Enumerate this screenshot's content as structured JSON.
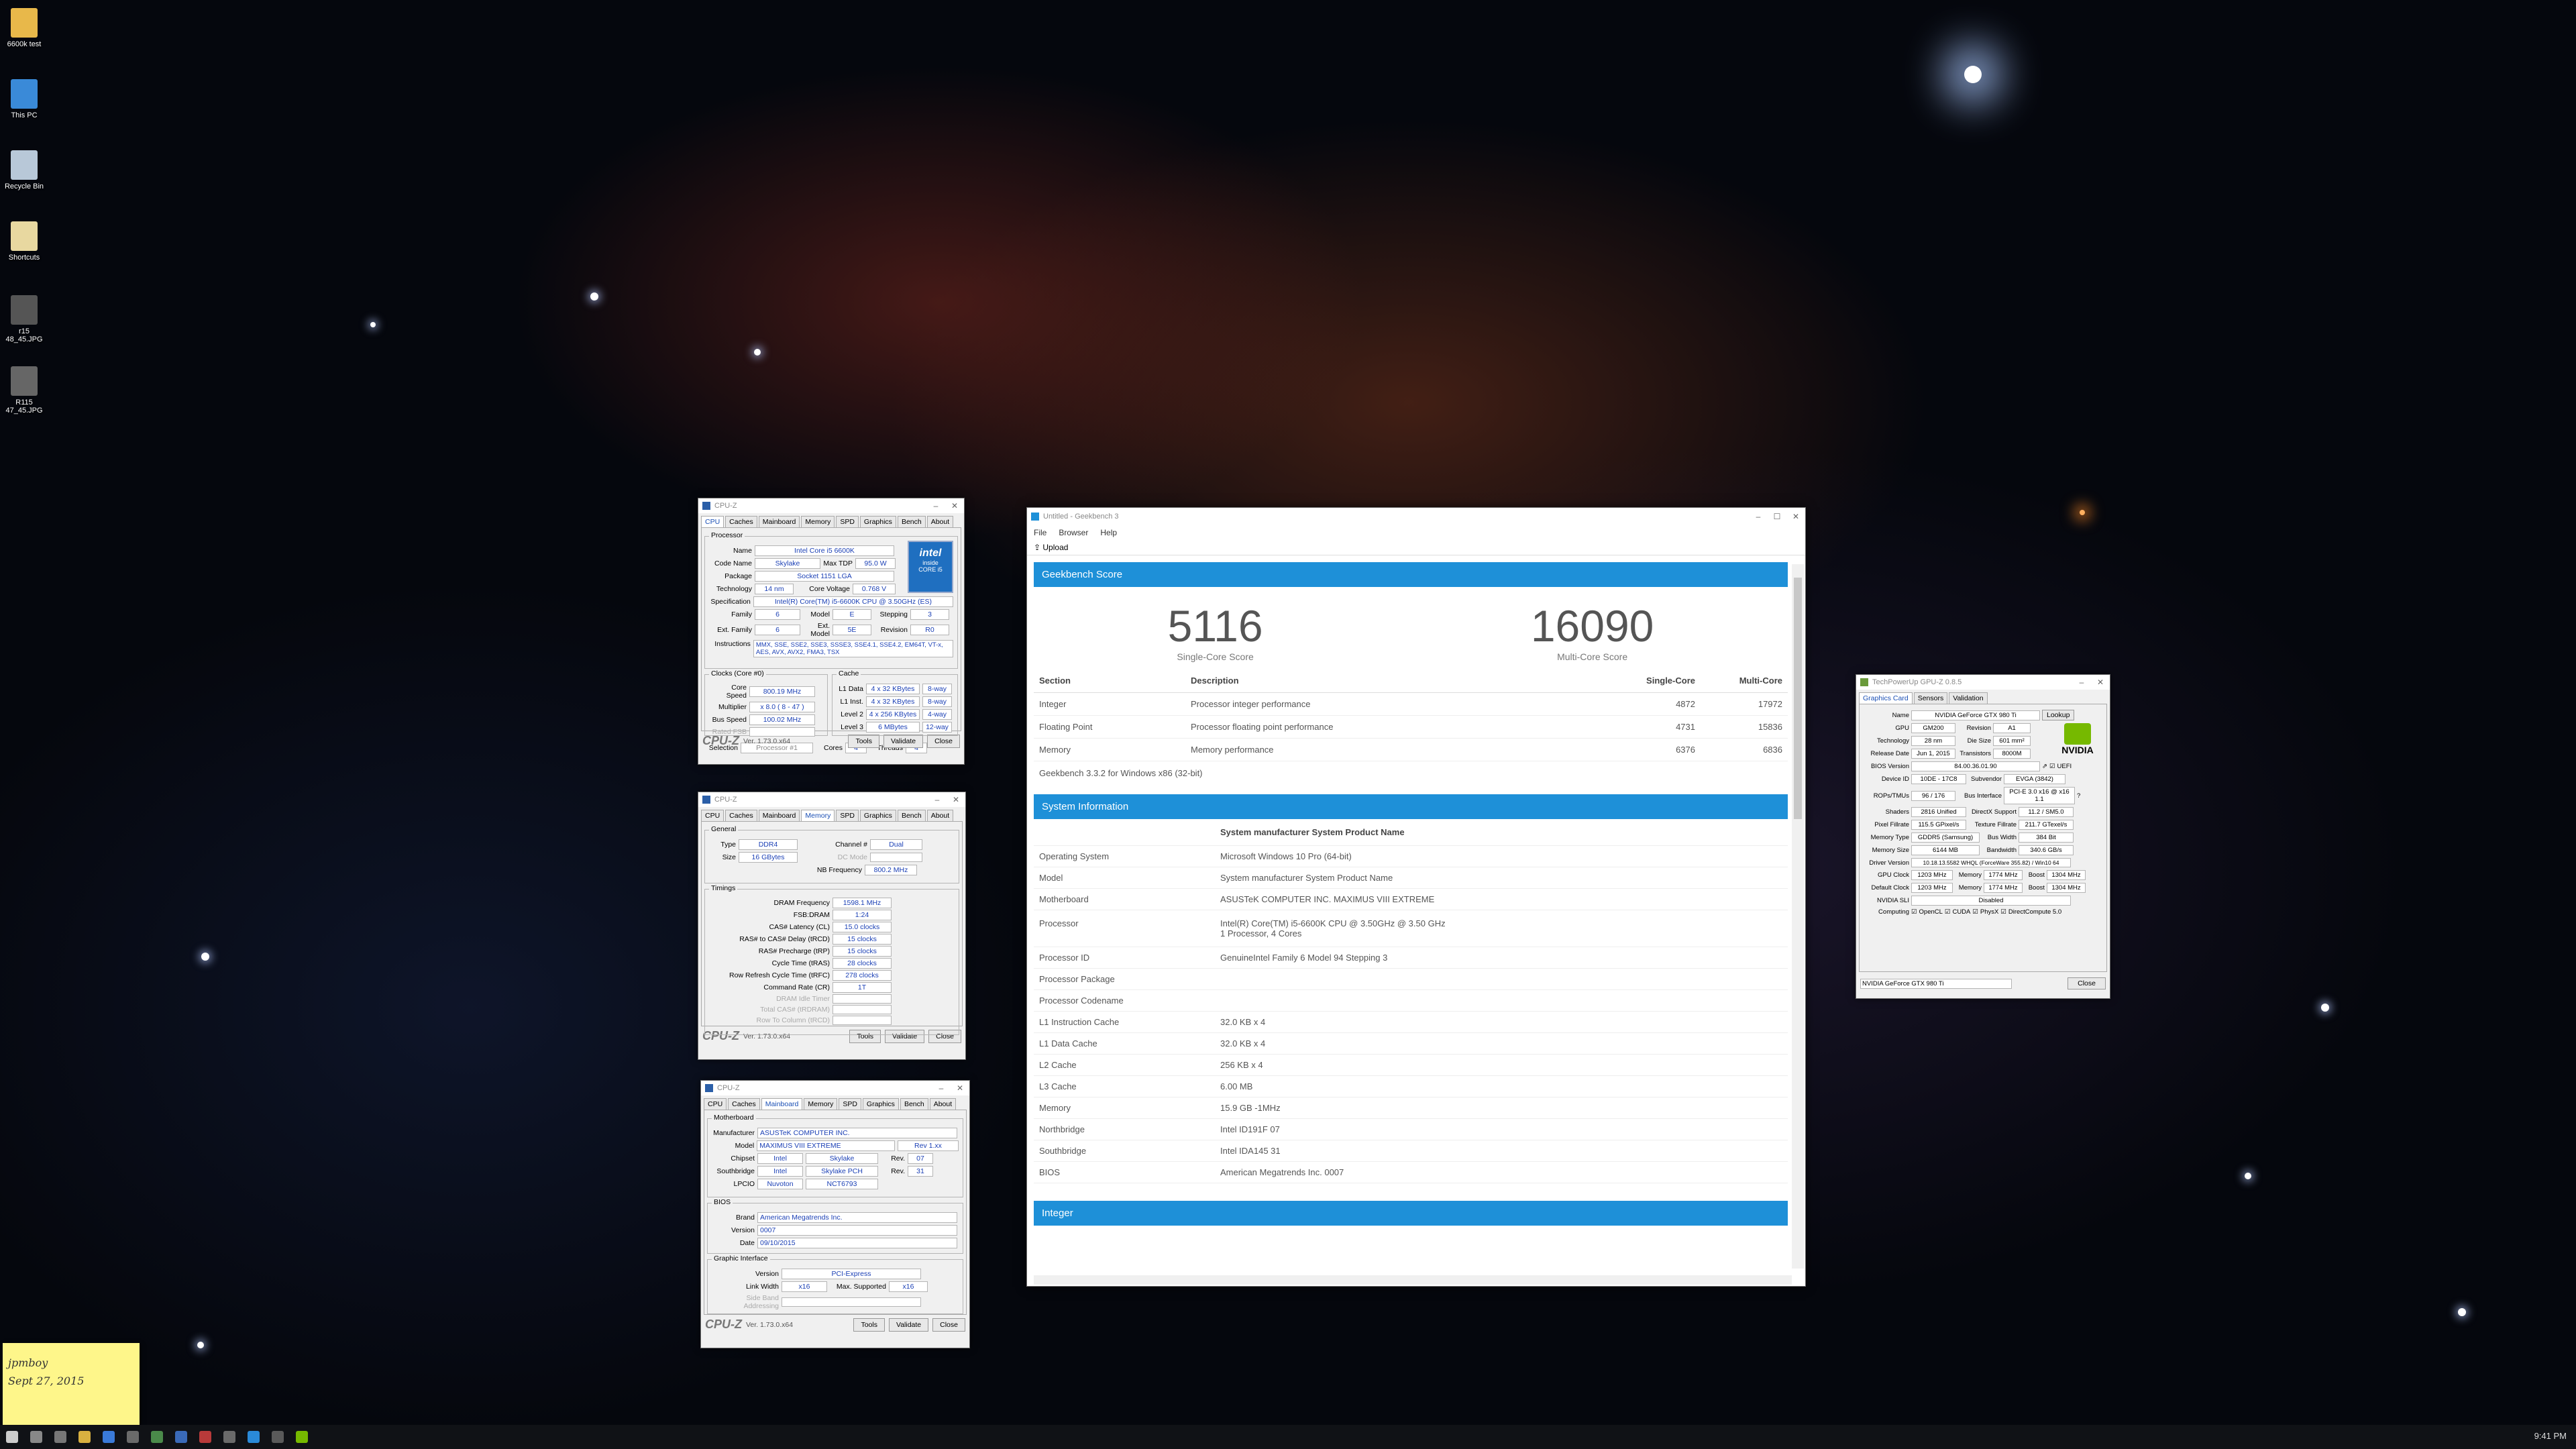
{
  "desktop": {
    "icons": [
      {
        "label": "6600k test"
      },
      {
        "label": "This PC"
      },
      {
        "label": "Recycle Bin"
      },
      {
        "label": "Shortcuts"
      },
      {
        "label": "r15 48_45.JPG"
      },
      {
        "label": "R115 47_45.JPG"
      }
    ]
  },
  "cpuz_cpu": {
    "title": "CPU-Z",
    "tabs": [
      "CPU",
      "Caches",
      "Mainboard",
      "Memory",
      "SPD",
      "Graphics",
      "Bench",
      "About"
    ],
    "active_tab": "CPU",
    "group_processor": "Processor",
    "name_label": "Name",
    "name": "Intel Core i5 6600K",
    "codename_label": "Code Name",
    "codename": "Skylake",
    "maxtdp_label": "Max TDP",
    "maxtdp": "95.0 W",
    "package_label": "Package",
    "package": "Socket 1151 LGA",
    "technology_label": "Technology",
    "technology": "14 nm",
    "voltage_label": "Core Voltage",
    "voltage": "0.768 V",
    "spec_label": "Specification",
    "spec": "Intel(R) Core(TM) i5-6600K CPU @ 3.50GHz (ES)",
    "family_label": "Family",
    "family": "6",
    "model_label": "Model",
    "model": "E",
    "stepping_label": "Stepping",
    "stepping": "3",
    "extfamily_label": "Ext. Family",
    "extfamily": "6",
    "extmodel_label": "Ext. Model",
    "extmodel": "5E",
    "revision_label": "Revision",
    "revision": "R0",
    "instructions_label": "Instructions",
    "instructions": "MMX, SSE, SSE2, SSE3, SSSE3, SSE4.1, SSE4.2, EM64T, VT-x, AES, AVX, AVX2, FMA3, TSX",
    "group_clocks": "Clocks (Core #0)",
    "corespeed_label": "Core Speed",
    "corespeed": "800.19 MHz",
    "multiplier_label": "Multiplier",
    "multiplier": "x 8.0 ( 8 - 47 )",
    "busspeed_label": "Bus Speed",
    "busspeed": "100.02 MHz",
    "ratedfsb_label": "Rated FSB",
    "group_cache": "Cache",
    "l1d_label": "L1 Data",
    "l1d": "4 x 32 KBytes",
    "l1d_way": "8-way",
    "l1i_label": "L1 Inst.",
    "l1i": "4 x 32 KBytes",
    "l1i_way": "8-way",
    "l2_label": "Level 2",
    "l2": "4 x 256 KBytes",
    "l2_way": "4-way",
    "l3_label": "Level 3",
    "l3": "6 MBytes",
    "l3_way": "12-way",
    "selection_label": "Selection",
    "selection": "Processor #1",
    "cores_label": "Cores",
    "cores": "4",
    "threads_label": "Threads",
    "threads": "4",
    "logo": "CPU-Z",
    "version": "Ver. 1.73.0.x64",
    "tools": "Tools",
    "validate": "Validate",
    "close": "Close",
    "intel_logo": "intel",
    "intel_inside": "inside",
    "intel_core": "CORE i5"
  },
  "cpuz_mem": {
    "title": "CPU-Z",
    "tabs": [
      "CPU",
      "Caches",
      "Mainboard",
      "Memory",
      "SPD",
      "Graphics",
      "Bench",
      "About"
    ],
    "active_tab": "Memory",
    "group_general": "General",
    "type_label": "Type",
    "type": "DDR4",
    "channel_label": "Channel #",
    "channel": "Dual",
    "size_label": "Size",
    "size": "16 GBytes",
    "dcmode_label": "DC Mode",
    "nbfreq_label": "NB Frequency",
    "nbfreq": "800.2 MHz",
    "group_timings": "Timings",
    "timings": [
      {
        "label": "DRAM Frequency",
        "value": "1598.1 MHz"
      },
      {
        "label": "FSB:DRAM",
        "value": "1:24"
      },
      {
        "label": "CAS# Latency (CL)",
        "value": "15.0 clocks"
      },
      {
        "label": "RAS# to CAS# Delay (tRCD)",
        "value": "15 clocks"
      },
      {
        "label": "RAS# Precharge (tRP)",
        "value": "15 clocks"
      },
      {
        "label": "Cycle Time (tRAS)",
        "value": "28 clocks"
      },
      {
        "label": "Row Refresh Cycle Time (tRFC)",
        "value": "278 clocks"
      },
      {
        "label": "Command Rate (CR)",
        "value": "1T"
      },
      {
        "label": "DRAM Idle Timer",
        "value": ""
      },
      {
        "label": "Total CAS# (tRDRAM)",
        "value": ""
      },
      {
        "label": "Row To Column (tRCD)",
        "value": ""
      }
    ],
    "logo": "CPU-Z",
    "version": "Ver. 1.73.0.x64",
    "tools": "Tools",
    "validate": "Validate",
    "close": "Close"
  },
  "cpuz_mb": {
    "title": "CPU-Z",
    "tabs": [
      "CPU",
      "Caches",
      "Mainboard",
      "Memory",
      "SPD",
      "Graphics",
      "Bench",
      "About"
    ],
    "active_tab": "Mainboard",
    "group_motherboard": "Motherboard",
    "manufacturer_label": "Manufacturer",
    "manufacturer": "ASUSTeK COMPUTER INC.",
    "model_label": "Model",
    "model": "MAXIMUS VIII EXTREME",
    "model_rev": "Rev 1.xx",
    "chipset_label": "Chipset",
    "chipset_vendor": "Intel",
    "chipset": "Skylake",
    "chipset_rev_label": "Rev.",
    "chipset_rev": "07",
    "southbridge_label": "Southbridge",
    "sb_vendor": "Intel",
    "southbridge": "Skylake PCH",
    "sb_rev_label": "Rev.",
    "sb_rev": "31",
    "lpcio_label": "LPCIO",
    "lpcio_vendor": "Nuvoton",
    "lpcio": "NCT6793",
    "group_bios": "BIOS",
    "brand_label": "Brand",
    "brand": "American Megatrends Inc.",
    "version_label": "Version",
    "bios_version": "0007",
    "date_label": "Date",
    "date": "09/10/2015",
    "group_graphic": "Graphic Interface",
    "gi_version_label": "Version",
    "gi_version": "PCI-Express",
    "linkwidth_label": "Link Width",
    "linkwidth": "x16",
    "maxsupported_label": "Max. Supported",
    "maxsupported": "x16",
    "sideband_label": "Side Band Addressing",
    "logo": "CPU-Z",
    "version": "Ver. 1.73.0.x64",
    "tools": "Tools",
    "validate": "Validate",
    "close": "Close"
  },
  "geekbench": {
    "title": "Untitled - Geekbench 3",
    "menu": [
      "File",
      "Browser",
      "Help"
    ],
    "toolbar_upload": "Upload",
    "score_header": "Geekbench Score",
    "single_score": "5116",
    "single_caption": "Single-Core Score",
    "multi_score": "16090",
    "multi_caption": "Multi-Core Score",
    "table_headers": {
      "section": "Section",
      "description": "Description",
      "single": "Single-Core",
      "multi": "Multi-Core"
    },
    "rows": [
      {
        "section": "Integer",
        "description": "Processor integer performance",
        "single": "4872",
        "multi": "17972"
      },
      {
        "section": "Floating Point",
        "description": "Processor floating point performance",
        "single": "4731",
        "multi": "15836"
      },
      {
        "section": "Memory",
        "description": "Memory performance",
        "single": "6376",
        "multi": "6836"
      }
    ],
    "version_note": "Geekbench 3.3.2 for Windows x86 (32-bit)",
    "sysinfo_header": "System Information",
    "sysinfo_title": "System manufacturer System Product Name",
    "sysinfo": [
      {
        "k": "Operating System",
        "v": "Microsoft Windows 10 Pro (64-bit)"
      },
      {
        "k": "Model",
        "v": "System manufacturer System Product Name"
      },
      {
        "k": "Motherboard",
        "v": "ASUSTeK COMPUTER INC. MAXIMUS VIII EXTREME"
      },
      {
        "k": "Processor",
        "v": "Intel(R) Core(TM) i5-6600K CPU @ 3.50GHz @ 3.50 GHz",
        "v2": "1 Processor, 4 Cores"
      },
      {
        "k": "Processor ID",
        "v": "GenuineIntel Family 6 Model 94 Stepping 3"
      },
      {
        "k": "Processor Package",
        "v": ""
      },
      {
        "k": "Processor Codename",
        "v": ""
      },
      {
        "k": "L1 Instruction Cache",
        "v": "32.0 KB x 4"
      },
      {
        "k": "L1 Data Cache",
        "v": "32.0 KB x 4"
      },
      {
        "k": "L2 Cache",
        "v": "256 KB x 4"
      },
      {
        "k": "L3 Cache",
        "v": "6.00 MB"
      },
      {
        "k": "Memory",
        "v": "15.9 GB -1MHz"
      },
      {
        "k": "Northbridge",
        "v": "Intel ID191F 07"
      },
      {
        "k": "Southbridge",
        "v": "Intel IDA145 31"
      },
      {
        "k": "BIOS",
        "v": "American Megatrends Inc. 0007"
      }
    ],
    "integer_header": "Integer"
  },
  "gpuz": {
    "title": "TechPowerUp GPU-Z 0.8.5",
    "tabs": [
      "Graphics Card",
      "Sensors",
      "Validation"
    ],
    "lookup": "Lookup",
    "name_label": "Name",
    "name": "NVIDIA GeForce GTX 980 Ti",
    "gpu_label": "GPU",
    "gpu": "GM200",
    "revision_label": "Revision",
    "revision": "A1",
    "tech_label": "Technology",
    "tech": "28 nm",
    "diesize_label": "Die Size",
    "diesize": "601 mm²",
    "release_label": "Release Date",
    "release": "Jun 1, 2015",
    "transistors_label": "Transistors",
    "transistors": "8000M",
    "bios_label": "BIOS Version",
    "bios": "84.00.36.01.90",
    "uefi": "UEFI",
    "deviceid_label": "Device ID",
    "deviceid": "10DE - 17C8",
    "subvendor_label": "Subvendor",
    "subvendor": "EVGA (3842)",
    "rops_label": "ROPs/TMUs",
    "rops": "96 / 176",
    "busif_label": "Bus Interface",
    "busif": "PCI-E 3.0 x16 @ x16 1.1",
    "shaders_label": "Shaders",
    "shaders": "2816 Unified",
    "dx_label": "DirectX Support",
    "dx": "11.2 / SM5.0",
    "pixel_label": "Pixel Fillrate",
    "pixel": "115.5 GPixel/s",
    "texture_label": "Texture Fillrate",
    "texture": "211.7 GTexel/s",
    "memtype_label": "Memory Type",
    "memtype": "GDDR5 (Samsung)",
    "buswidth_label": "Bus Width",
    "buswidth": "384 Bit",
    "memsize_label": "Memory Size",
    "memsize": "6144 MB",
    "bandwidth_label": "Bandwidth",
    "bandwidth": "340.6 GB/s",
    "driver_label": "Driver Version",
    "driver": "10.18.13.5582 WHQL (ForceWare 355.82) / Win10 64",
    "gpuclock_label": "GPU Clock",
    "gpuclock": "1203 MHz",
    "mem_label": "Memory",
    "memclock": "1774 MHz",
    "boost_label": "Boost",
    "boost": "1304 MHz",
    "defclock_label": "Default Clock",
    "defclock": "1203 MHz",
    "defmem": "1774 MHz",
    "defboost": "1304 MHz",
    "sli_label": "NVIDIA SLI",
    "sli": "Disabled",
    "computing_label": "Computing",
    "computing": [
      "OpenCL",
      "CUDA",
      "PhysX",
      "DirectCompute 5.0"
    ],
    "selected_card": "NVIDIA GeForce GTX 980 Ti",
    "close": "Close",
    "nvidia_logo": "NVIDIA"
  },
  "sticky": {
    "line1": "jpmboy",
    "line2": "Sept 27, 2015"
  },
  "taskbar": {
    "clock": "9:41 PM"
  }
}
